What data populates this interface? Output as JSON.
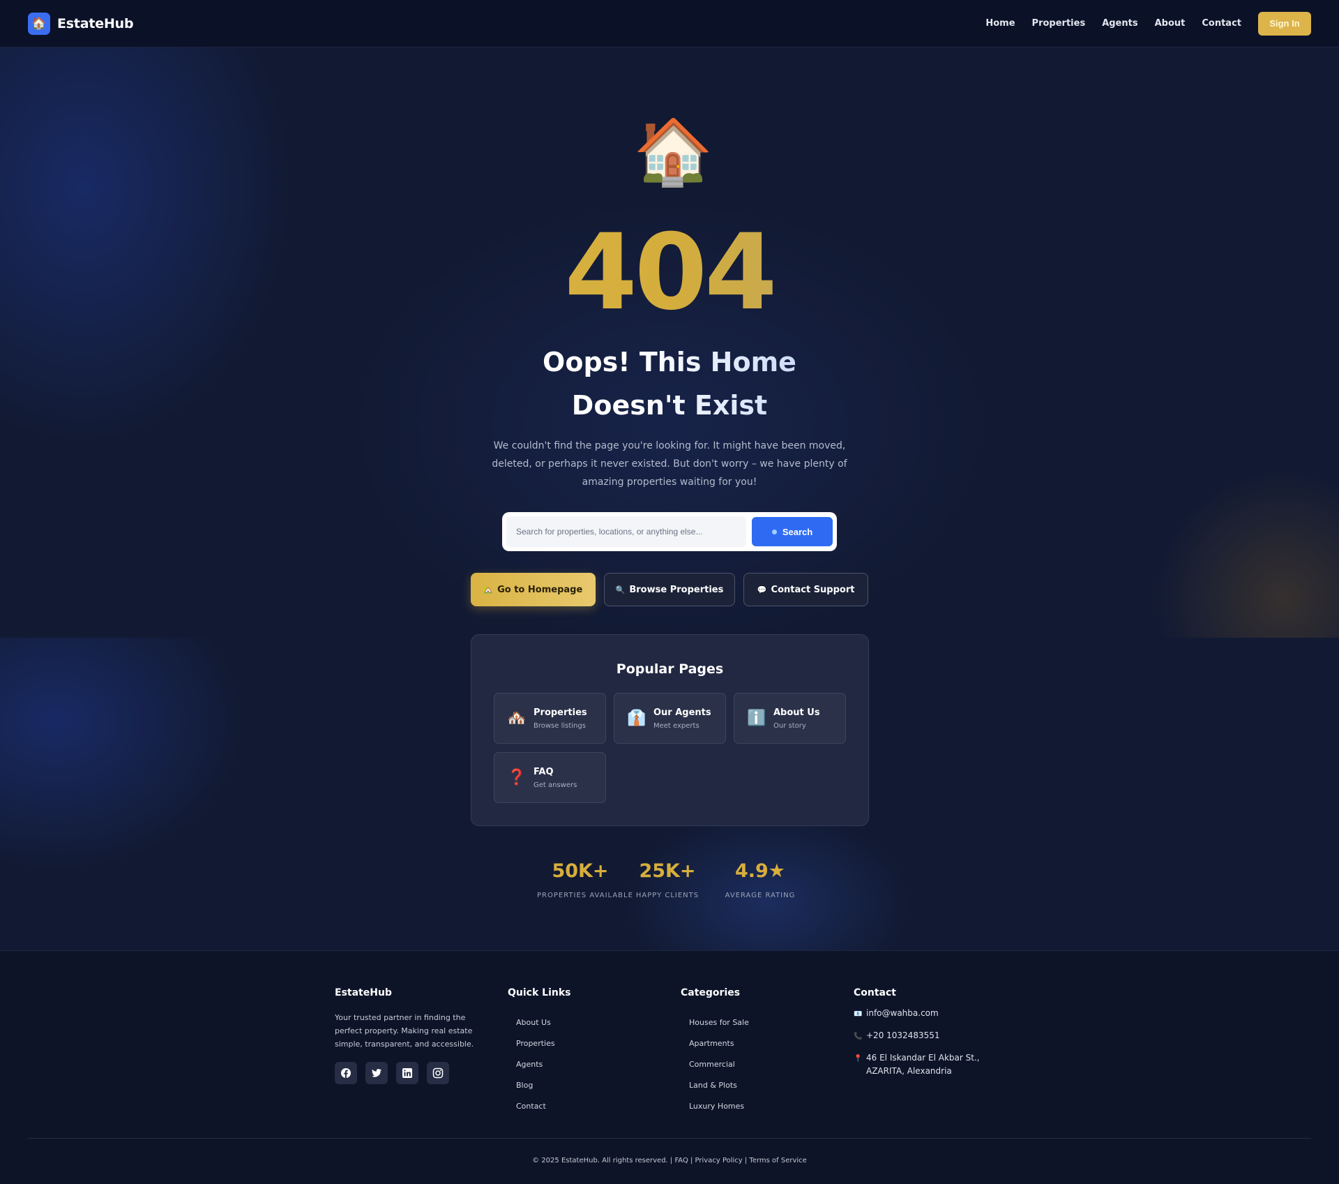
{
  "nav": {
    "brand_icon": "house-icon",
    "brand_name": "EstateHub",
    "links": [
      "Home",
      "Properties",
      "Agents",
      "About",
      "Contact"
    ],
    "signin_label": "Sign In"
  },
  "hero": {
    "emoji": "🏠",
    "code": "404",
    "headline": "Oops! This Home Doesn't Exist",
    "subtext": "We couldn't find the page you're looking for. It might have been moved, deleted, or perhaps it never existed. But don't worry – we have plenty of amazing properties waiting for you!",
    "search": {
      "placeholder": "Search for properties, locations, or anything else...",
      "value": "",
      "button_label": "Search"
    },
    "actions": {
      "home_icon": "🏡",
      "home_label": "Go to Homepage",
      "browse_icon": "🔍",
      "browse_label": "Browse Properties",
      "support_icon": "💬",
      "support_label": "Contact Support"
    }
  },
  "popular": {
    "title": "Popular Pages",
    "items": [
      {
        "icon": "🏘️",
        "title": "Properties",
        "subtitle": "Browse listings"
      },
      {
        "icon": "👔",
        "title": "Our Agents",
        "subtitle": "Meet experts"
      },
      {
        "icon": "ℹ️",
        "title": "About Us",
        "subtitle": "Our story"
      },
      {
        "icon": "❓",
        "title": "FAQ",
        "subtitle": "Get answers"
      }
    ]
  },
  "stats": [
    {
      "value": "50K+",
      "label": "PROPERTIES AVAILABLE"
    },
    {
      "value": "25K+",
      "label": "HAPPY CLIENTS"
    },
    {
      "value": "4.9★",
      "label": "AVERAGE RATING"
    }
  ],
  "footer": {
    "about": {
      "title": "EstateHub",
      "description": "Your trusted partner in finding the perfect property. Making real estate simple, transparent, and accessible.",
      "socials": [
        "facebook-icon",
        "twitter-icon",
        "linkedin-icon",
        "instagram-icon"
      ]
    },
    "quick_links": {
      "title": "Quick Links",
      "items": [
        "About Us",
        "Properties",
        "Agents",
        "Blog",
        "Contact"
      ]
    },
    "categories": {
      "title": "Categories",
      "items": [
        "Houses for Sale",
        "Apartments",
        "Commercial",
        "Land & Plots",
        "Luxury Homes"
      ]
    },
    "contact": {
      "title": "Contact",
      "email_icon": "📧",
      "email": "info@wahba.com",
      "phone_icon": "📞",
      "phone": "+20 1032483551",
      "address_icon": "📍",
      "address": "46 El Iskandar El Akbar St., AZARITA, Alexandria"
    },
    "copyright": "© 2025 EstateHub. All rights reserved. | FAQ | Privacy Policy | Terms of Service"
  },
  "colors": {
    "accent_gold": "#dcb44a",
    "accent_blue": "#2f6bf2",
    "background": "#121a33"
  }
}
